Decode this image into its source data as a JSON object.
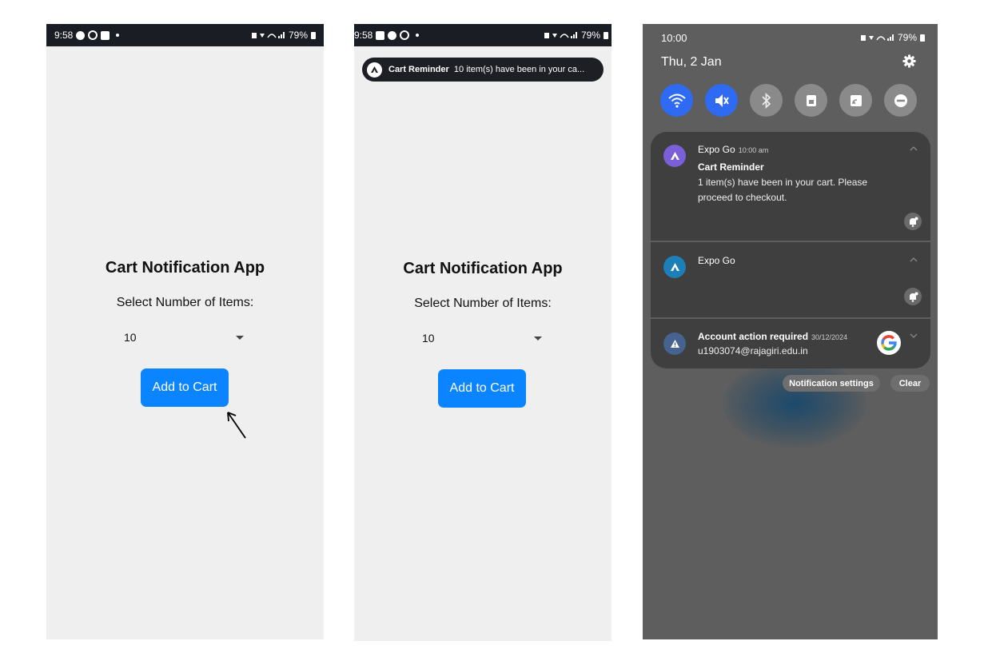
{
  "screen1": {
    "status": {
      "time": "9:58",
      "battery": "79%"
    },
    "app": {
      "title": "Cart Notification App",
      "subtitle": "Select Number of Items:",
      "selected_count": "10",
      "add_button": "Add to Cart"
    }
  },
  "screen2": {
    "status": {
      "time": "9:58",
      "battery": "79%"
    },
    "heads_up": {
      "title": "Cart Reminder",
      "text": "10 item(s) have been in your ca..."
    },
    "app": {
      "title": "Cart Notification App",
      "subtitle": "Select Number of Items:",
      "selected_count": "10",
      "add_button": "Add to Cart"
    }
  },
  "screen3": {
    "status": {
      "time": "10:00",
      "battery": "79%"
    },
    "date": "Thu, 2 Jan",
    "quick_settings": [
      {
        "icon": "wifi-icon",
        "on": true
      },
      {
        "icon": "sound-off-icon",
        "on": true
      },
      {
        "icon": "bluetooth-icon",
        "on": false
      },
      {
        "icon": "lock-icon",
        "on": false
      },
      {
        "icon": "cast-icon",
        "on": false
      },
      {
        "icon": "do-not-disturb-icon",
        "on": false
      }
    ],
    "notifications": [
      {
        "app": "Expo Go",
        "time": "10:00 am",
        "title": "Cart Reminder",
        "body": "1 item(s) have been in your cart. Please proceed to checkout."
      },
      {
        "app": "Expo Go"
      },
      {
        "title": "Account action required",
        "time": "30/12/2024",
        "body": "u1903074@rajagiri.edu.in"
      }
    ],
    "buttons": {
      "settings": "Notification settings",
      "clear": "Clear"
    }
  },
  "colors": {
    "accent": "#0a84ff",
    "quick_on": "#2f6bf2",
    "status_bar": "#1a1d24"
  }
}
